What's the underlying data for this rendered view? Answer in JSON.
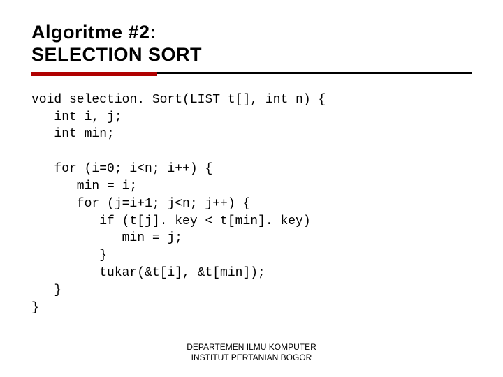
{
  "title_line1": "Algoritme #2:",
  "title_line2": "SELECTION SORT",
  "code": "void selection. Sort(LIST t[], int n) {\n   int i, j;\n   int min;\n\n   for (i=0; i<n; i++) {\n      min = i;\n      for (j=i+1; j<n; j++) {\n         if (t[j]. key < t[min]. key)\n            min = j;\n         }\n         tukar(&t[i], &t[min]);\n   }\n}",
  "footer_line1": "DEPARTEMEN ILMU KOMPUTER",
  "footer_line2": "INSTITUT PERTANIAN BOGOR"
}
